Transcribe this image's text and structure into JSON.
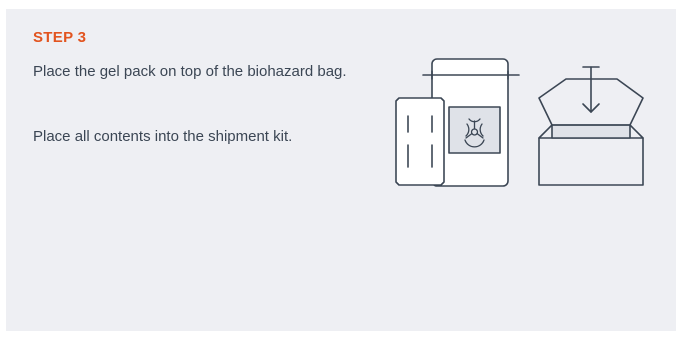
{
  "step": {
    "label": "STEP 3",
    "paragraphs": [
      "Place the gel pack on top of the biohazard bag.",
      "Place all contents into the shipment kit."
    ]
  },
  "illustration": {
    "icons": [
      "gel-pack-icon",
      "biohazard-bag-icon",
      "biohazard-symbol-icon",
      "shipment-box-icon",
      "down-arrow-icon"
    ],
    "stroke_color": "#3b4654",
    "bag_fill": "#ffffff",
    "window_fill": "#dfe2e8",
    "box_tray_fill": "#dfe2e8"
  },
  "colors": {
    "accent": "#e2541f",
    "text": "#3b4654",
    "background": "#eeeff3"
  }
}
